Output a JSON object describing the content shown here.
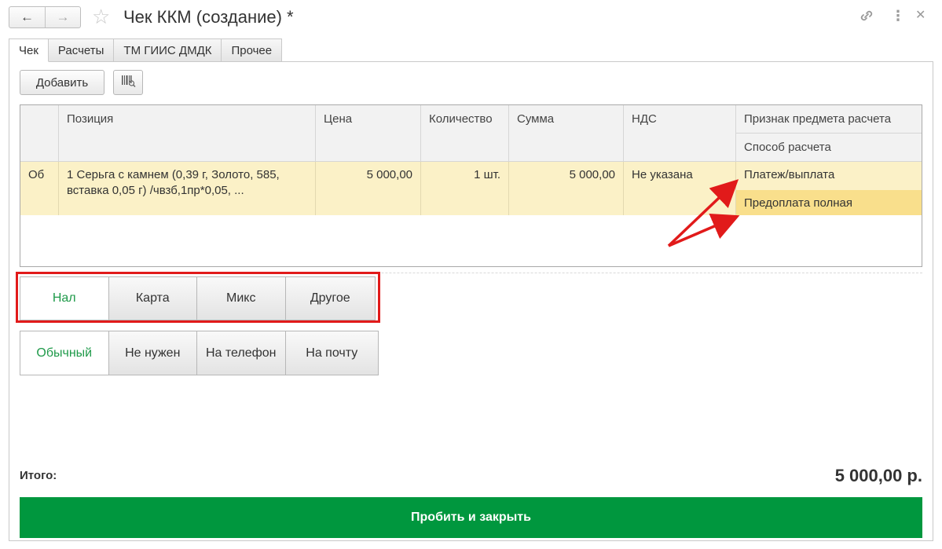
{
  "window": {
    "title": "Чек ККМ (создание) *",
    "back_icon": "←",
    "forward_icon": "→",
    "star_icon": "☆",
    "link_icon": "link-icon",
    "more_icon": "⋮",
    "close_icon": "✕"
  },
  "tabs": [
    "Чек",
    "Расчеты",
    "ТМ ГИИС ДМДК",
    "Прочее"
  ],
  "toolbar": {
    "add_label": "Добавить",
    "scan_icon": "barcode-scan-icon"
  },
  "table": {
    "headers": {
      "status": "",
      "position": "Позиция",
      "price": "Цена",
      "quantity": "Количество",
      "sum": "Сумма",
      "vat": "НДС",
      "payment_subject": "Признак предмета расчета",
      "payment_method": "Способ расчета"
    },
    "rows": [
      {
        "status": "Об",
        "position": "1 Серьга с камнем (0,39 г, Золото, 585, вставка 0,05 г) /чвзб,1пр*0,05, ...",
        "price": "5 000,00",
        "quantity": "1 шт.",
        "sum": "5 000,00",
        "vat": "Не указана",
        "payment_subject": "Платеж/выплата",
        "payment_method": "Предоплата полная"
      }
    ]
  },
  "payment_types": {
    "options": [
      "Нал",
      "Карта",
      "Микс",
      "Другое"
    ],
    "selected": "Нал"
  },
  "receipt_delivery": {
    "options": [
      "Обычный",
      "Не нужен",
      "На телефон",
      "На почту"
    ],
    "selected": "Обычный"
  },
  "totals": {
    "label": "Итого:",
    "value": "5 000,00 р."
  },
  "submit_label": "Пробить и закрыть",
  "colors": {
    "accent_green": "#00973e",
    "selected_text": "#1f9a4a",
    "row_highlight": "#fbf1c7",
    "annotation_red": "#e11a1a"
  }
}
